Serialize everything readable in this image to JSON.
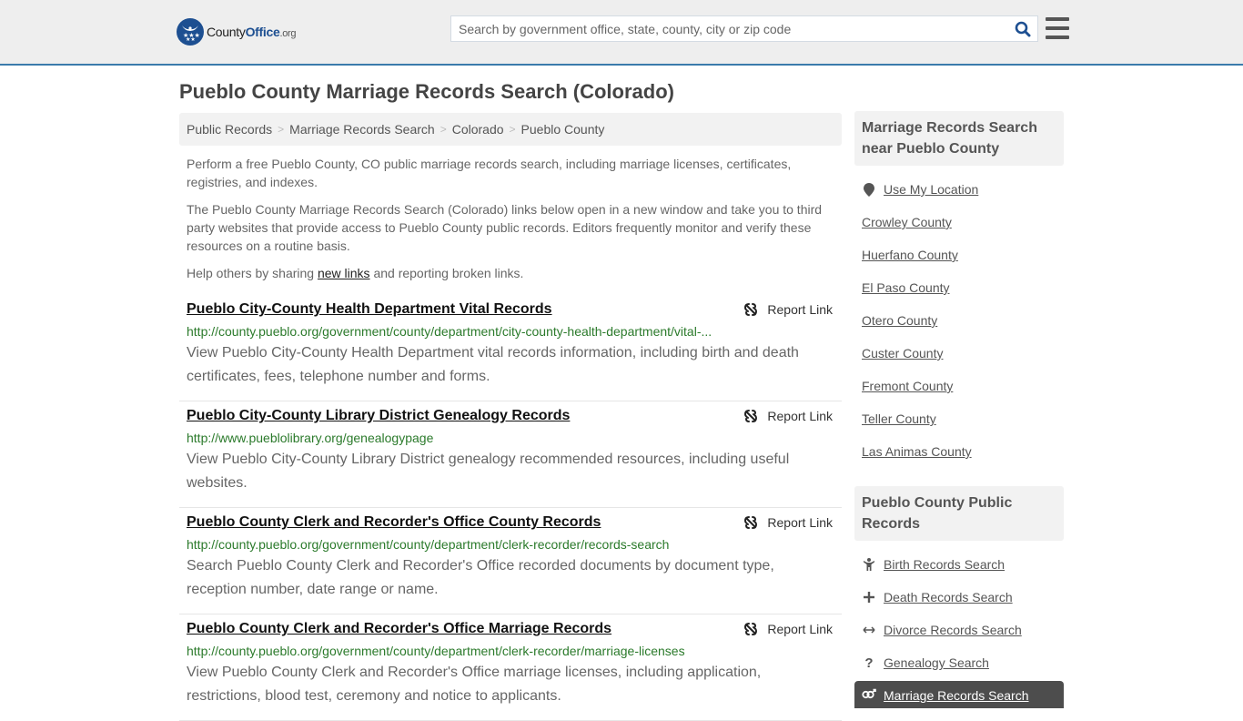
{
  "header": {
    "logo": {
      "name": "County",
      "office": "Office",
      "tld": ".org"
    },
    "search": {
      "placeholder": "Search by government office, state, county, city or zip code",
      "value": ""
    },
    "brand_color": "#1d4f91",
    "accent_border": "#3a7bab"
  },
  "page": {
    "title": "Pueblo County Marriage Records Search (Colorado)"
  },
  "breadcrumb": [
    {
      "label": "Public Records"
    },
    {
      "label": "Marriage Records Search"
    },
    {
      "label": "Colorado"
    },
    {
      "label": "Pueblo County"
    }
  ],
  "intro": {
    "p1": "Perform a free Pueblo County, CO public marriage records search, including marriage licenses, certificates, registries, and indexes.",
    "p2": "The Pueblo County Marriage Records Search (Colorado) links below open in a new window and take you to third party websites that provide access to Pueblo County public records. Editors frequently monitor and verify these resources on a routine basis.",
    "p3_before": "Help others by sharing ",
    "p3_link": "new links",
    "p3_after": " and reporting broken links."
  },
  "report_label": "Report Link",
  "results": [
    {
      "title": "Pueblo City-County Health Department Vital Records",
      "url": "http://county.pueblo.org/government/county/department/city-county-health-department/vital-...",
      "description": "View Pueblo City-County Health Department vital records information, including birth and death certificates, fees, telephone number and forms."
    },
    {
      "title": "Pueblo City-County Library District Genealogy Records",
      "url": "http://www.pueblolibrary.org/genealogypage",
      "description": "View Pueblo City-County Library District genealogy recommended resources, including useful websites."
    },
    {
      "title": "Pueblo County Clerk and Recorder's Office County Records",
      "url": "http://county.pueblo.org/government/county/department/clerk-recorder/records-search",
      "description": "Search Pueblo County Clerk and Recorder's Office recorded documents by document type, reception number, date range or name."
    },
    {
      "title": "Pueblo County Clerk and Recorder's Office Marriage Records",
      "url": "http://county.pueblo.org/government/county/department/clerk-recorder/marriage-licenses",
      "description": "View Pueblo County Clerk and Recorder's Office marriage licenses, including application, restrictions, blood test, ceremony and notice to applicants."
    }
  ],
  "sidebar": {
    "nearby": {
      "heading": "Marriage Records Search near Pueblo County",
      "use_location": {
        "label": "Use My Location",
        "icon": "map-marker-icon"
      },
      "counties": [
        "Crowley County",
        "Huerfano County",
        "El Paso County",
        "Otero County",
        "Custer County",
        "Fremont County",
        "Teller County",
        "Las Animas County"
      ]
    },
    "public_records": {
      "heading": "Pueblo County Public Records",
      "items": [
        {
          "label": "Birth Records Search",
          "icon": "child-icon"
        },
        {
          "label": "Death Records Search",
          "icon": "plus-icon"
        },
        {
          "label": "Divorce Records Search",
          "icon": "arrows-horizontal-icon"
        },
        {
          "label": "Genealogy Search",
          "icon": "question-icon"
        },
        {
          "label": "Marriage Records Search",
          "icon": "venus-mars-icon",
          "active": true
        }
      ]
    }
  }
}
